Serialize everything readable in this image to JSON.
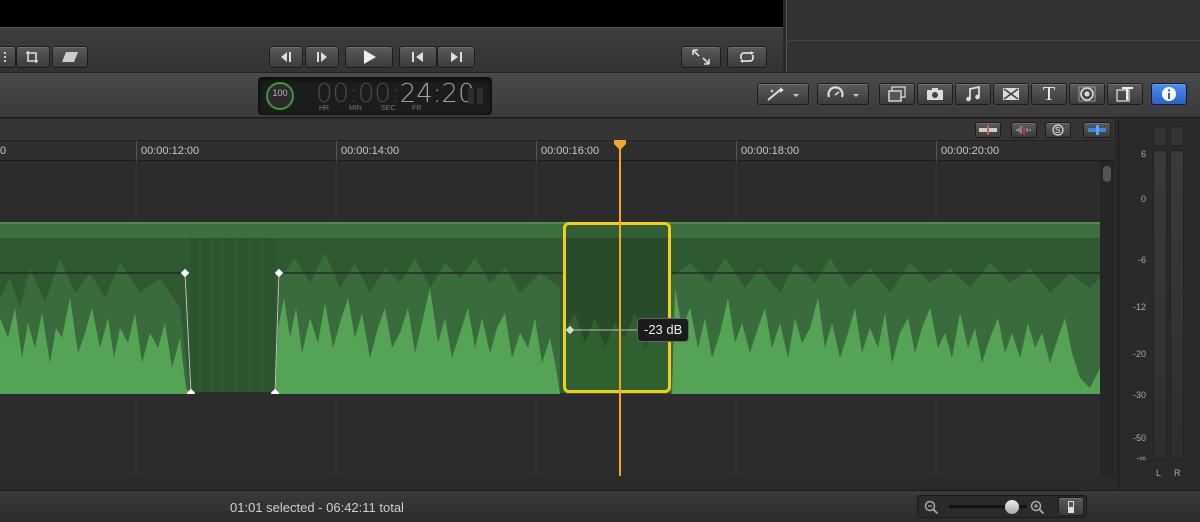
{
  "timecode": {
    "percent": "100",
    "dim_part": "00:00:",
    "bright_part": "24:20",
    "units": [
      "HR",
      "MIN",
      "SEC",
      "FR"
    ]
  },
  "ruler": {
    "labels": [
      "00:00:12:00",
      "00:00:14:00",
      "00:00:16:00",
      "00:00:18:00",
      "00:00:20:00"
    ],
    "partial_label": "0"
  },
  "clip": {
    "volume_label": "-23 dB"
  },
  "meter": {
    "scale": [
      "6",
      "0",
      "-6",
      "-12",
      "-20",
      "-30",
      "-50",
      "-∞"
    ],
    "channels": [
      "L",
      "R"
    ]
  },
  "status": {
    "text": "01:01 selected - 06:42:11 total"
  },
  "colors": {
    "clip_fill": "#2f5a31",
    "waveform": "#55a455",
    "selection_border": "#f0cf1a",
    "playhead": "#f2a531",
    "info_button": "#2f6fd6"
  },
  "icons": {
    "inspector": "info-icon",
    "import": "camera-icon",
    "music": "music-icon",
    "titles": "T-icon"
  }
}
